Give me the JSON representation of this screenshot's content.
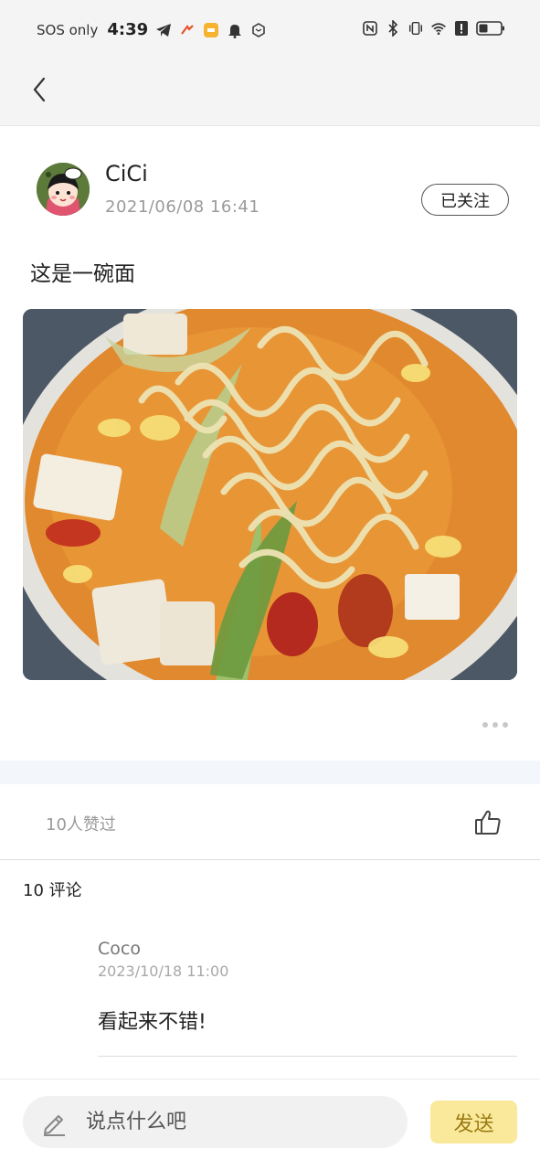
{
  "status_bar": {
    "carrier": "SOS only",
    "time": "4:39",
    "icons_left": [
      "telegram-icon",
      "app-icon",
      "notification-app-icon",
      "bell-icon",
      "box-icon"
    ],
    "icons_right": [
      "nfc-icon",
      "bluetooth-icon",
      "vibrate-icon",
      "wifi-icon",
      "alert-icon",
      "battery-icon"
    ]
  },
  "nav": {
    "back_icon": "chevron-left-icon"
  },
  "post": {
    "author": "CiCi",
    "time": "2021/06/08  16:41",
    "follow_label": "已关注",
    "text": "这是一碗面",
    "image_description_icon": "noodle-soup-photo",
    "more_icon": "more-dots-icon"
  },
  "likes": {
    "text": "10人赞过",
    "icon": "thumbs-up-icon"
  },
  "comments": {
    "count_label": "10 评论",
    "items": [
      {
        "author": "Coco",
        "time": "2023/10/18  11:00",
        "text": "看起来不错!"
      }
    ]
  },
  "composer": {
    "placeholder": "说点什么吧",
    "icon": "pencil-icon",
    "send_label": "发送"
  },
  "colors": {
    "send_bg": "#fae99a",
    "send_text": "#9a7b14",
    "band": "#f3f6fa"
  }
}
